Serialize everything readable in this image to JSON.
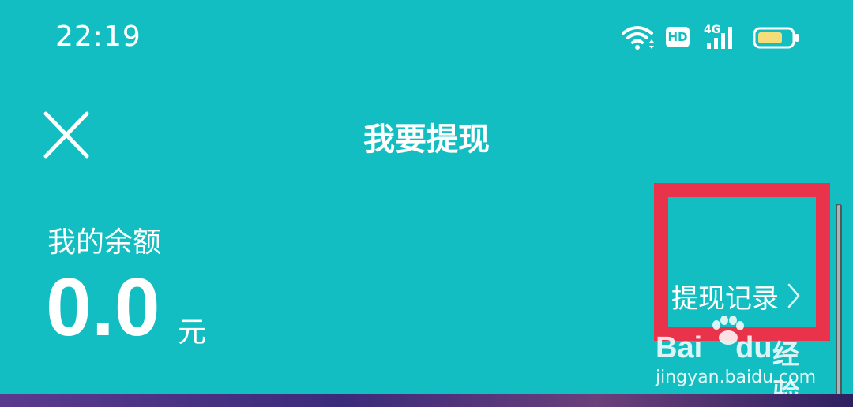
{
  "status_bar": {
    "time": "22:19",
    "hd_badge": "HD",
    "network_type": "4G",
    "icons": [
      "wifi-icon",
      "hd-icon",
      "signal-icon",
      "battery-icon"
    ]
  },
  "header": {
    "title": "我要提现",
    "close_icon": "close-icon"
  },
  "balance": {
    "label": "我的余额",
    "amount": "0.0",
    "unit": "元"
  },
  "record_link": {
    "label": "提现记录",
    "icon": "chevron-right-icon"
  },
  "watermark": {
    "brand": "Bai",
    "brand_suffix": "du",
    "name": "经验",
    "url": "jingyan.baidu.com"
  },
  "colors": {
    "background": "#12bec2",
    "text": "#ffffff",
    "highlight": "#e8334a",
    "battery_fill": "#f3de7a"
  }
}
